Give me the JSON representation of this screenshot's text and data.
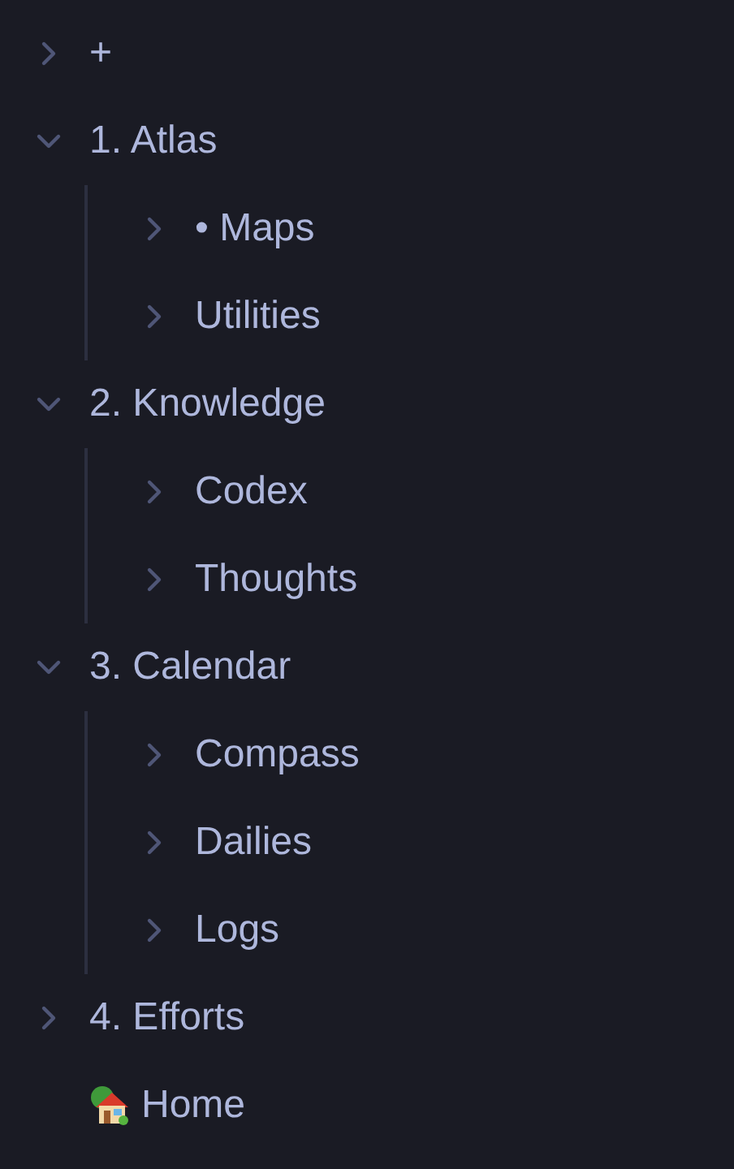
{
  "tree": [
    {
      "kind": "folder",
      "label": "+",
      "expanded": false
    },
    {
      "kind": "folder",
      "label": "1. Atlas",
      "expanded": true,
      "children": [
        {
          "kind": "folder",
          "label": "• Maps",
          "expanded": false
        },
        {
          "kind": "folder",
          "label": "Utilities",
          "expanded": false
        }
      ]
    },
    {
      "kind": "folder",
      "label": "2. Knowledge",
      "expanded": true,
      "children": [
        {
          "kind": "folder",
          "label": "Codex",
          "expanded": false
        },
        {
          "kind": "folder",
          "label": "Thoughts",
          "expanded": false
        }
      ]
    },
    {
      "kind": "folder",
      "label": "3. Calendar",
      "expanded": true,
      "children": [
        {
          "kind": "folder",
          "label": "Compass",
          "expanded": false
        },
        {
          "kind": "folder",
          "label": "Dailies",
          "expanded": false
        },
        {
          "kind": "folder",
          "label": "Logs",
          "expanded": false
        }
      ]
    },
    {
      "kind": "folder",
      "label": "4. Efforts",
      "expanded": false
    },
    {
      "kind": "home-file",
      "label": "Home"
    }
  ]
}
